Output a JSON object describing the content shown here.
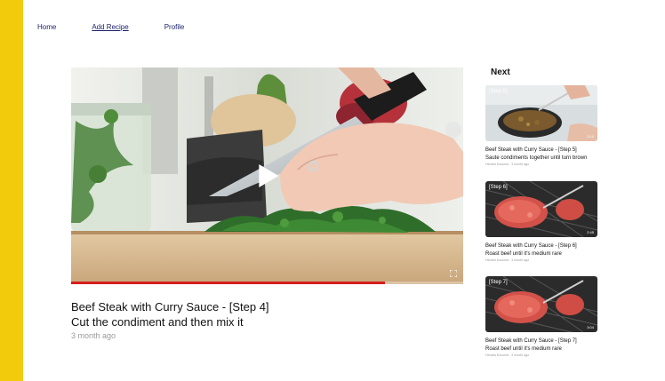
{
  "nav": {
    "home": "Home",
    "add_recipe": "Add Recipe",
    "profile": "Profile"
  },
  "player": {
    "progress": 0.8,
    "icons": {
      "play": "play-icon",
      "fullscreen": "fullscreen-icon"
    }
  },
  "video": {
    "title_line1": "Beef Steak with Curry Sauce - [Step 4]",
    "title_line2": "Cut the condiment and then mix it",
    "meta": "3 month ago"
  },
  "next": {
    "heading": "Next",
    "items": [
      {
        "step_badge": "[Step 5]",
        "duration": "3:10",
        "title_line1": "Beef Steak with Curry Sauce - [Step 5]",
        "title_line2": "Saute condiments together until turn brown",
        "meta": "Hendra Kusuma · 3 month ago"
      },
      {
        "step_badge": "[Step 6]",
        "duration": "2:45",
        "title_line1": "Beef Steak with Curry Sauce - [Step 6]",
        "title_line2": "Roast beef until it's medium rare",
        "meta": "Hendra Kusuma · 3 month ago"
      },
      {
        "step_badge": "[Step 7]",
        "duration": "3:04",
        "title_line1": "Beef Steak with Curry Sauce - [Step 7]",
        "title_line2": "Roast beef until it's medium rare",
        "meta": "Hendra Kusuma · 3 month ago"
      }
    ]
  },
  "colors": {
    "accent_yellow": "#f2cc0c",
    "nav_text": "#1b1f6b",
    "progress_red": "#d61f1f"
  }
}
